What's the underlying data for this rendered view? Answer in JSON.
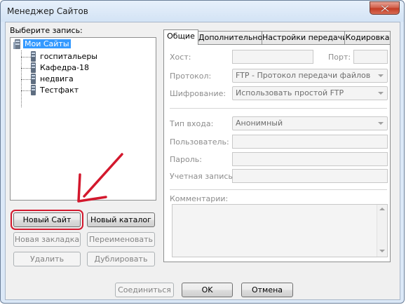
{
  "window": {
    "title": "Менеджер Сайтов"
  },
  "left": {
    "select_label": "Выберите запись:",
    "tree": {
      "root": "Мои Сайты",
      "items": [
        "госпитальеры",
        "Кафедра-18",
        "недвига",
        "Тестфакт"
      ]
    },
    "buttons": {
      "new_site": "Новый Сайт",
      "new_folder": "Новый каталог",
      "new_bookmark": "Новая закладка",
      "rename": "Переименовать",
      "delete": "Удалить",
      "duplicate": "Дублировать"
    }
  },
  "tabs": [
    "Общие",
    "Дополнительно",
    "Настройки передачи",
    "Кодировка"
  ],
  "general": {
    "host_label": "Хост:",
    "port_label": "Порт:",
    "protocol_label": "Протокол:",
    "protocol_value": "FTP - Протокол передачи файлов",
    "encryption_label": "Шифрование:",
    "encryption_value": "Использовать простой FTP",
    "logon_label": "Тип входа:",
    "logon_value": "Анонимный",
    "user_label": "Пользователь:",
    "password_label": "Пароль:",
    "account_label": "Учетная запись:",
    "comments_label": "Комментарии:"
  },
  "footer": {
    "connect": "Соединиться",
    "ok": "OK",
    "cancel": "Отмена"
  },
  "colors": {
    "annotation_red": "#d3182d",
    "selection": "#3399ff"
  },
  "icons": {
    "root": "server-group-icon",
    "site": "server-icon",
    "close": "close-icon"
  }
}
